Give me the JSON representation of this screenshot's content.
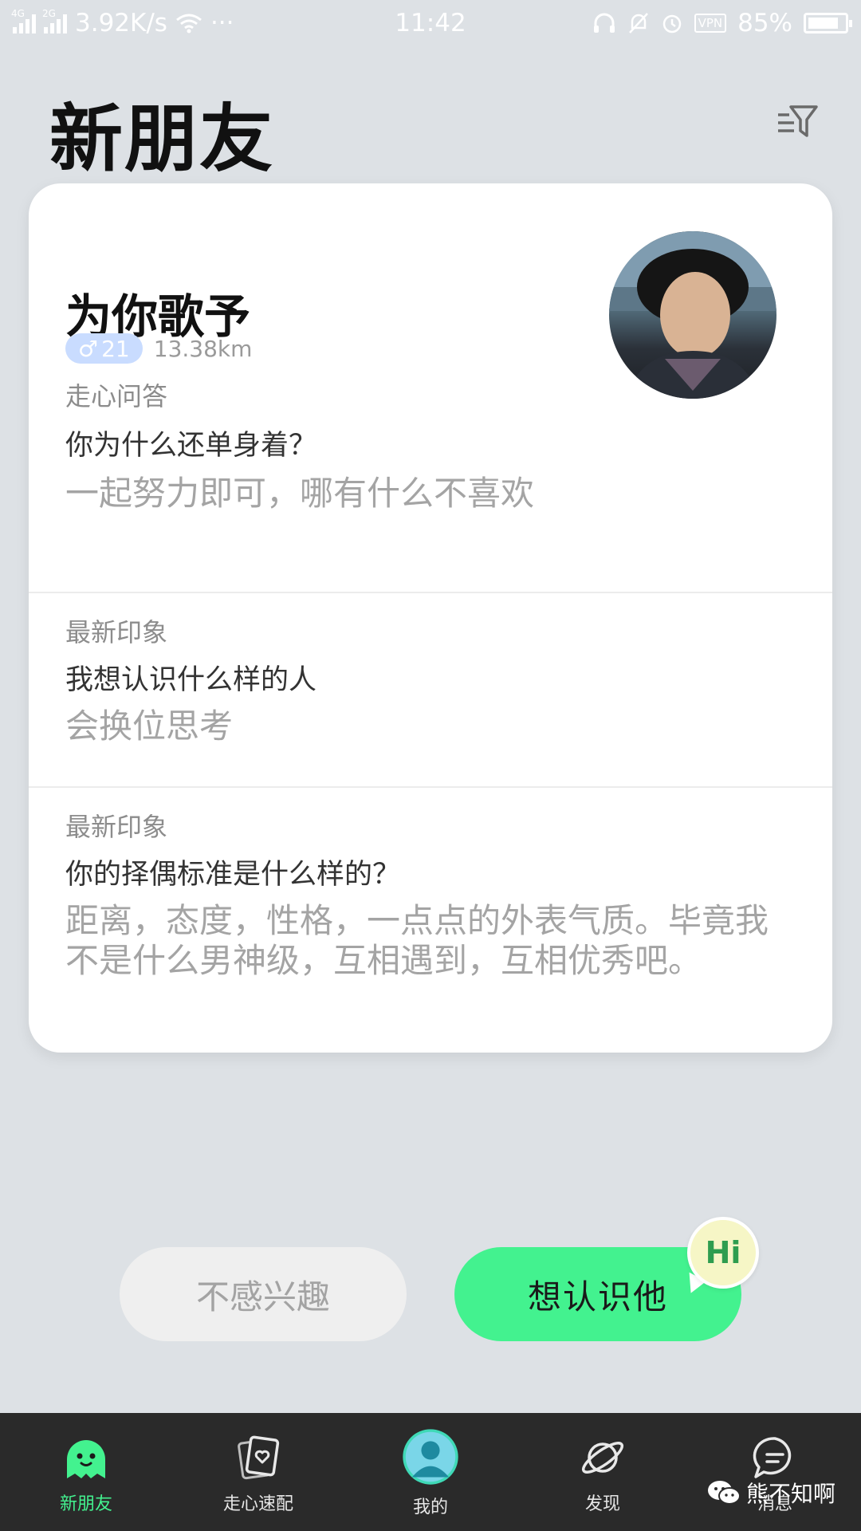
{
  "status_bar": {
    "network_1": "4G",
    "network_2": "2G",
    "speed": "3.92K/s",
    "more": "···",
    "time": "11:42",
    "vpn": "VPN",
    "battery_text": "85%",
    "battery_level": 0.85
  },
  "header": {
    "title": "新朋友"
  },
  "profile": {
    "name": "为你歌予",
    "gender_symbol": "♂",
    "age": "21",
    "distance": "13.38km"
  },
  "sections": [
    {
      "label": "走心问答",
      "question": "你为什么还单身着？",
      "answer": "一起努力即可，哪有什么不喜欢"
    },
    {
      "label": "最新印象",
      "question": "我想认识什么样的人",
      "answer": "会换位思考"
    },
    {
      "label": "最新印象",
      "question": "你的择偶标准是什么样的？",
      "answer": "距离，态度，性格，一点点的外表气质。毕竟我不是什么男神级，互相遇到，互相优秀吧。"
    }
  ],
  "actions": {
    "pass_label": "不感兴趣",
    "like_label": "想认识他",
    "hi_label": "Hi"
  },
  "bottom_nav": [
    {
      "label": "新朋友",
      "icon": "ghost-face-icon",
      "active": true
    },
    {
      "label": "走心速配",
      "icon": "cards-heart-icon",
      "active": false
    },
    {
      "label": "我的",
      "icon": "profile-avatar-icon",
      "active": false
    },
    {
      "label": "发现",
      "icon": "planet-icon",
      "active": false
    },
    {
      "label": "消息",
      "icon": "chat-bubble-icon",
      "active": false
    }
  ],
  "watermark": {
    "text": "熊不知啊",
    "icon": "wechat-icon"
  },
  "colors": {
    "accent": "#43f28f",
    "background": "#dde1e5",
    "nav_background": "#2a2a2a",
    "badge": "#c9dcff"
  }
}
